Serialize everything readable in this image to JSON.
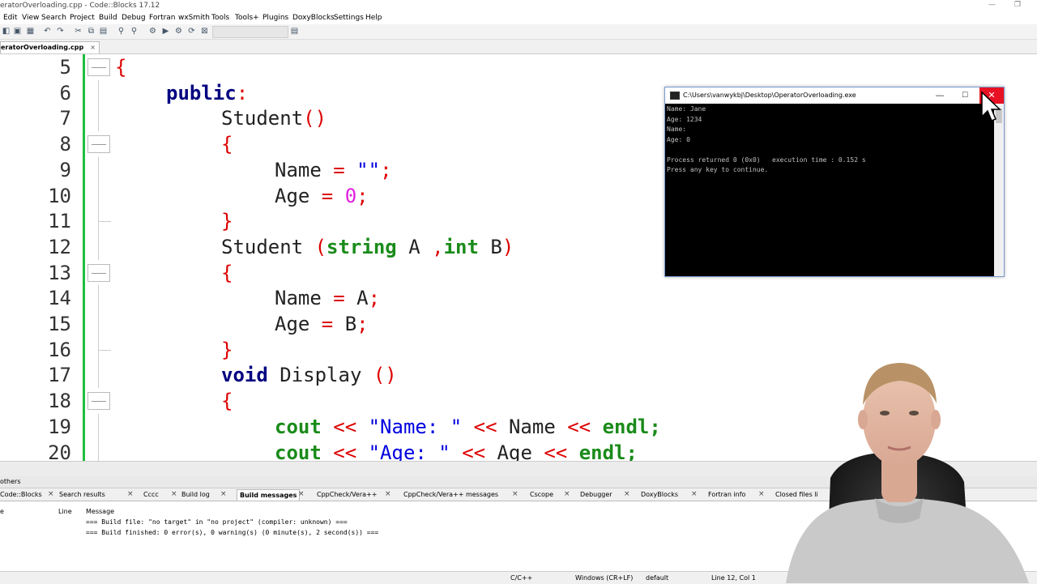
{
  "window": {
    "title": "eratorOverloading.cpp - Code::Blocks 17.12"
  },
  "menu": [
    "Edit",
    "View",
    "Search",
    "Project",
    "Build",
    "Debug",
    "Fortran",
    "wxSmith",
    "Tools",
    "Tools+",
    "Plugins",
    "DoxyBlocks",
    "Settings",
    "Help"
  ],
  "editor": {
    "tab_label": "eratorOverloading.cpp",
    "tab_close": "×",
    "lines": [
      {
        "num": "5",
        "fold": "box",
        "indent": 142,
        "tokens": [
          {
            "t": "{",
            "c": "punc"
          }
        ]
      },
      {
        "num": "6",
        "fold": "line",
        "indent": 205,
        "tokens": [
          {
            "t": "public",
            "c": "kw2"
          },
          {
            "t": ":",
            "c": "punc"
          }
        ]
      },
      {
        "num": "7",
        "fold": "line",
        "indent": 273,
        "tokens": [
          {
            "t": "Student",
            "c": ""
          },
          {
            "t": "()",
            "c": "punc"
          }
        ]
      },
      {
        "num": "8",
        "fold": "box",
        "indent": 273,
        "tokens": [
          {
            "t": "{",
            "c": "punc"
          }
        ]
      },
      {
        "num": "9",
        "fold": "line",
        "indent": 339,
        "tokens": [
          {
            "t": "Name ",
            "c": ""
          },
          {
            "t": "= ",
            "c": "punc"
          },
          {
            "t": "\"\"",
            "c": "str"
          },
          {
            "t": ";",
            "c": "punc"
          }
        ]
      },
      {
        "num": "10",
        "fold": "line",
        "indent": 339,
        "tokens": [
          {
            "t": "Age ",
            "c": ""
          },
          {
            "t": "= ",
            "c": "punc"
          },
          {
            "t": "0",
            "c": "num"
          },
          {
            "t": ";",
            "c": "punc"
          }
        ]
      },
      {
        "num": "11",
        "fold": "end",
        "indent": 273,
        "tokens": [
          {
            "t": "}",
            "c": "punc"
          }
        ]
      },
      {
        "num": "12",
        "fold": "line",
        "indent": 273,
        "tokens": [
          {
            "t": "Student ",
            "c": ""
          },
          {
            "t": "(",
            "c": "punc"
          },
          {
            "t": "string",
            "c": "kw"
          },
          {
            "t": " A ",
            "c": ""
          },
          {
            "t": ",",
            "c": "punc"
          },
          {
            "t": "int",
            "c": "kw"
          },
          {
            "t": " B",
            "c": ""
          },
          {
            "t": ")",
            "c": "punc"
          }
        ]
      },
      {
        "num": "13",
        "fold": "box",
        "indent": 273,
        "tokens": [
          {
            "t": "{",
            "c": "punc"
          }
        ]
      },
      {
        "num": "14",
        "fold": "line",
        "indent": 339,
        "tokens": [
          {
            "t": "Name ",
            "c": ""
          },
          {
            "t": "= ",
            "c": "punc"
          },
          {
            "t": "A",
            "c": ""
          },
          {
            "t": ";",
            "c": "punc"
          }
        ]
      },
      {
        "num": "15",
        "fold": "line",
        "indent": 339,
        "tokens": [
          {
            "t": "Age ",
            "c": ""
          },
          {
            "t": "= ",
            "c": "punc"
          },
          {
            "t": "B",
            "c": ""
          },
          {
            "t": ";",
            "c": "punc"
          }
        ]
      },
      {
        "num": "16",
        "fold": "end",
        "indent": 273,
        "tokens": [
          {
            "t": "}",
            "c": "punc"
          }
        ]
      },
      {
        "num": "17",
        "fold": "line",
        "indent": 273,
        "tokens": [
          {
            "t": "void",
            "c": "kw2"
          },
          {
            "t": " Display ",
            "c": ""
          },
          {
            "t": "()",
            "c": "punc"
          }
        ]
      },
      {
        "num": "18",
        "fold": "box",
        "indent": 273,
        "tokens": [
          {
            "t": "{",
            "c": "punc"
          }
        ]
      },
      {
        "num": "19",
        "fold": "line",
        "indent": 339,
        "tokens": [
          {
            "t": "cout",
            "c": "kw"
          },
          {
            "t": " << ",
            "c": "punc"
          },
          {
            "t": "\"Name: \"",
            "c": "str"
          },
          {
            "t": " << ",
            "c": "punc"
          },
          {
            "t": "Name",
            "c": ""
          },
          {
            "t": " << ",
            "c": "punc"
          },
          {
            "t": "endl",
            "c": "kw"
          },
          {
            "t": ";",
            "c": "kw"
          }
        ]
      },
      {
        "num": "20",
        "fold": "line",
        "indent": 339,
        "tokens": [
          {
            "t": "cout",
            "c": "kw"
          },
          {
            "t": " << ",
            "c": "punc"
          },
          {
            "t": "\"Age: \"",
            "c": "str"
          },
          {
            "t": " << ",
            "c": "punc"
          },
          {
            "t": "Age",
            "c": ""
          },
          {
            "t": " << ",
            "c": "punc"
          },
          {
            "t": "endl",
            "c": "kw"
          },
          {
            "t": ";",
            "c": "kw"
          }
        ]
      }
    ]
  },
  "console": {
    "title": "C:\\Users\\vanwykbj\\Desktop\\OperatorOverloading.exe",
    "min": "—",
    "max": "☐",
    "close": "✕",
    "lines": [
      "Name: Jane",
      "Age: 1234",
      "Name:",
      "Age: 0",
      "",
      "Process returned 0 (0x0)   execution time : 0.152 s",
      "Press any key to continue."
    ]
  },
  "logs": {
    "title": "others",
    "tabs": [
      {
        "label": "Code::Blocks",
        "active": false
      },
      {
        "label": "Search results",
        "active": false
      },
      {
        "label": "Cccc",
        "active": false
      },
      {
        "label": "Build log",
        "active": false
      },
      {
        "label": "Build messages",
        "active": true
      },
      {
        "label": "CppCheck/Vera++",
        "active": false
      },
      {
        "label": "CppCheck/Vera++ messages",
        "active": false
      },
      {
        "label": "Cscope",
        "active": false
      },
      {
        "label": "Debugger",
        "active": false
      },
      {
        "label": "DoxyBlocks",
        "active": false
      },
      {
        "label": "Fortran info",
        "active": false
      },
      {
        "label": "Closed files li",
        "active": false
      }
    ],
    "columns": {
      "file": "e",
      "line": "Line",
      "message": "Message"
    },
    "rows": [
      "=== Build file: \"no target\" in \"no project\" (compiler: unknown) ===",
      "=== Build finished: 0 error(s), 0 warning(s) (0 minute(s), 2 second(s)) ==="
    ]
  },
  "status": {
    "language": "C/C++",
    "eol": "Windows (CR+LF)",
    "encoding": "default",
    "position": "Line 12, Col 1"
  },
  "colors": {
    "accent_close": "#e81123",
    "change_bar": "#1fbf3f",
    "keyword_green": "#1a8b1a",
    "keyword_navy": "#000080",
    "operator_red": "#dd0000",
    "string_blue": "#0000e0",
    "number_magenta": "#e020e0"
  }
}
